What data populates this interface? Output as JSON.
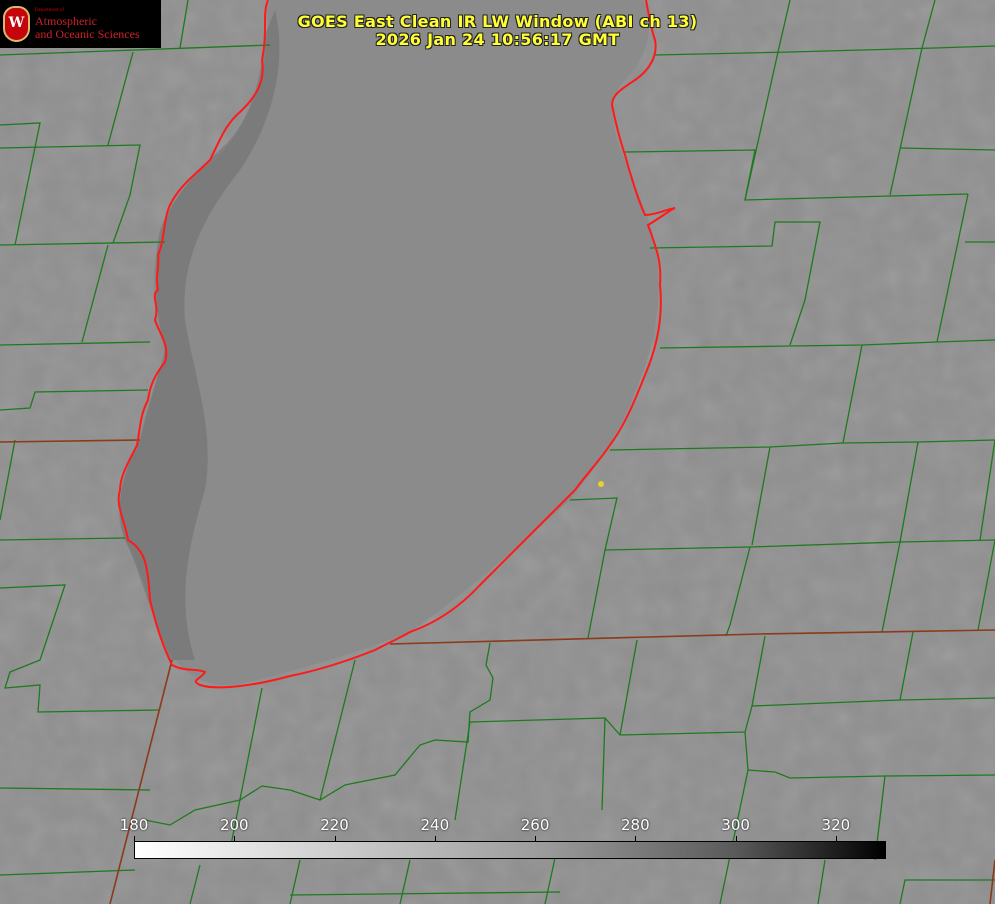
{
  "title": {
    "line1": "GOES East Clean IR LW Window (ABI ch 13)",
    "line2": "2026 Jan 24 10:56:17 GMT"
  },
  "logo": {
    "seal_letter": "W",
    "dept": "Department of",
    "line1": "Atmospheric",
    "line2": "and Oceanic Sciences"
  },
  "colorbar": {
    "ticks": [
      "180",
      "200",
      "220",
      "240",
      "260",
      "280",
      "300",
      "320"
    ],
    "min": 180,
    "max": 330,
    "gradient": "white-to-black"
  },
  "colors": {
    "background": "#8f8f8f",
    "county_lines": "#1e7a1e",
    "state_lines": "#8b3a1a",
    "coastline": "#ff1a1a",
    "title_text": "#ffff33",
    "marker": "#e6d22e"
  }
}
